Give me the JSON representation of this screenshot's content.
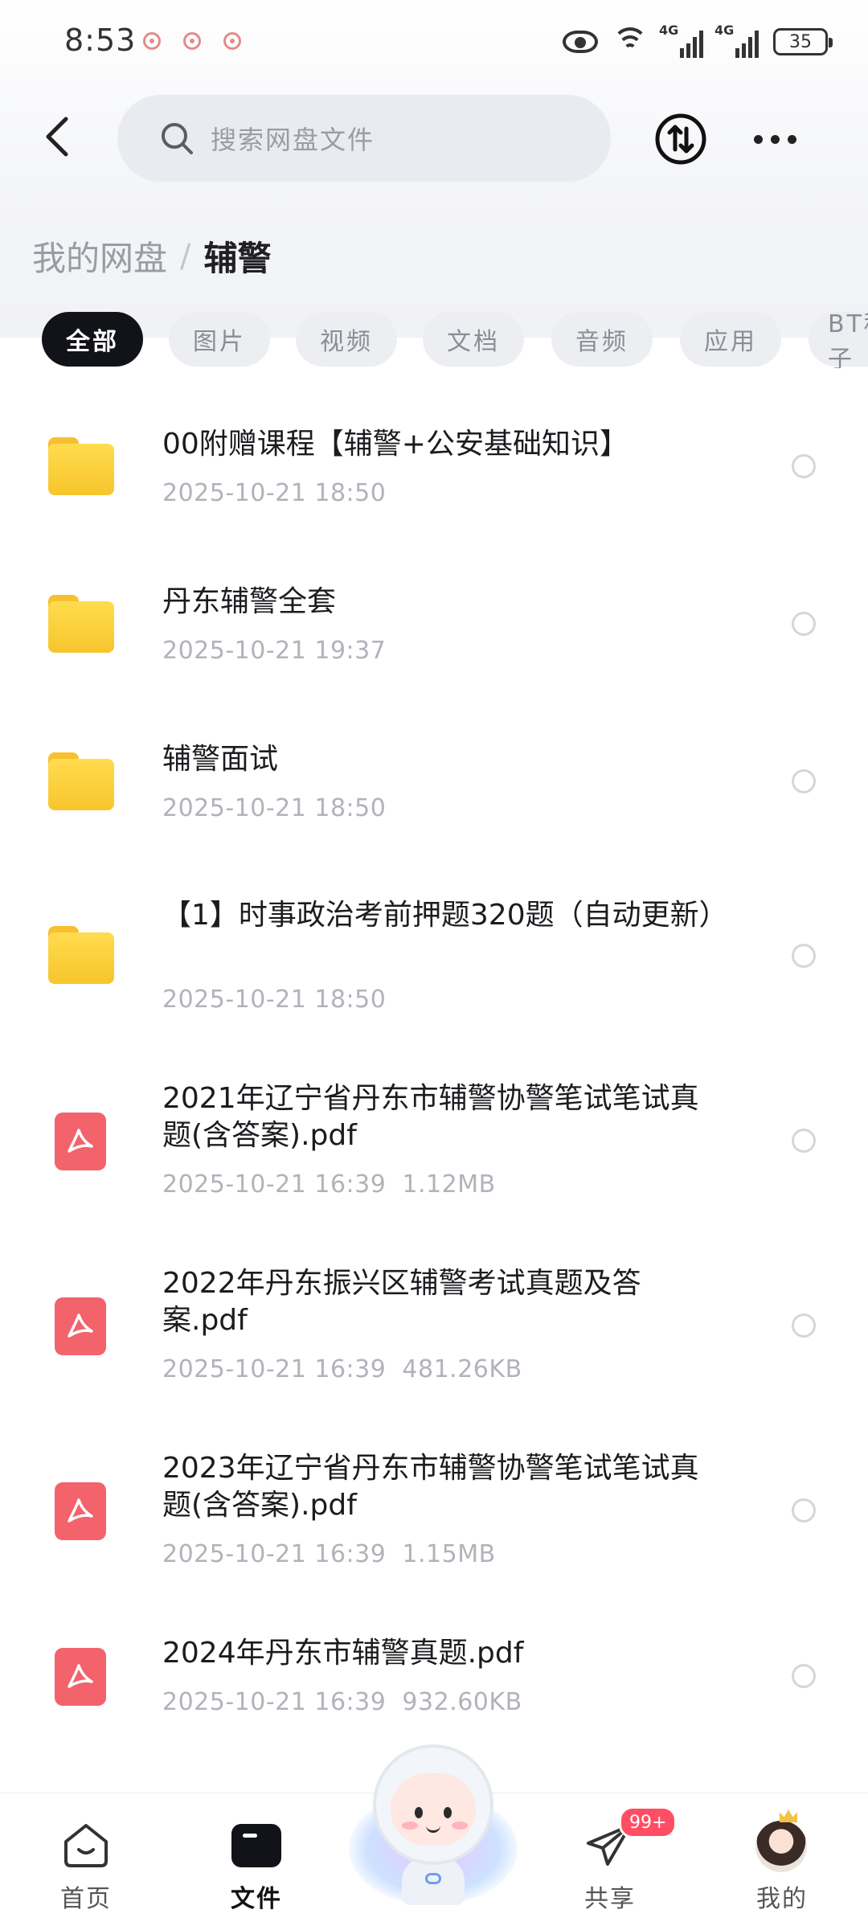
{
  "status_bar": {
    "time": "8:53",
    "battery": "35",
    "signal1_label": "4G",
    "signal2_label": "4G"
  },
  "header": {
    "search_placeholder": "搜索网盘文件"
  },
  "breadcrumb": {
    "root": "我的网盘",
    "separator": "/",
    "current": "辅警"
  },
  "tabs": [
    {
      "label": "全部",
      "active": true
    },
    {
      "label": "图片",
      "active": false
    },
    {
      "label": "视频",
      "active": false
    },
    {
      "label": "文档",
      "active": false
    },
    {
      "label": "音频",
      "active": false
    },
    {
      "label": "应用",
      "active": false
    },
    {
      "label": "BT种子",
      "active": false
    }
  ],
  "files": [
    {
      "type": "folder",
      "name": "00附赠课程【辅警+公安基础知识】",
      "date": "2025-10-21 18:50",
      "size": ""
    },
    {
      "type": "folder",
      "name": "丹东辅警全套",
      "date": "2025-10-21 19:37",
      "size": ""
    },
    {
      "type": "folder",
      "name": "辅警面试",
      "date": "2025-10-21 18:50",
      "size": ""
    },
    {
      "type": "folder",
      "name": "【1】时事政治考前押题320题（自动更新）",
      "date": "2025-10-21 18:50",
      "size": ""
    },
    {
      "type": "pdf",
      "name": "2021年辽宁省丹东市辅警协警笔试笔试真题(含答案).pdf",
      "date": "2025-10-21 16:39",
      "size": "1.12MB"
    },
    {
      "type": "pdf",
      "name": "2022年丹东振兴区辅警考试真题及答案.pdf",
      "date": "2025-10-21 16:39",
      "size": "481.26KB"
    },
    {
      "type": "pdf",
      "name": "2023年辽宁省丹东市辅警协警笔试笔试真题(含答案).pdf",
      "date": "2025-10-21 16:39",
      "size": "1.15MB"
    },
    {
      "type": "pdf",
      "name": "2024年丹东市辅警真题.pdf",
      "date": "2025-10-21 16:39",
      "size": "932.60KB"
    }
  ],
  "bottom_nav": {
    "home": "首页",
    "files": "文件",
    "share": "共享",
    "share_badge": "99+",
    "me": "我的"
  }
}
